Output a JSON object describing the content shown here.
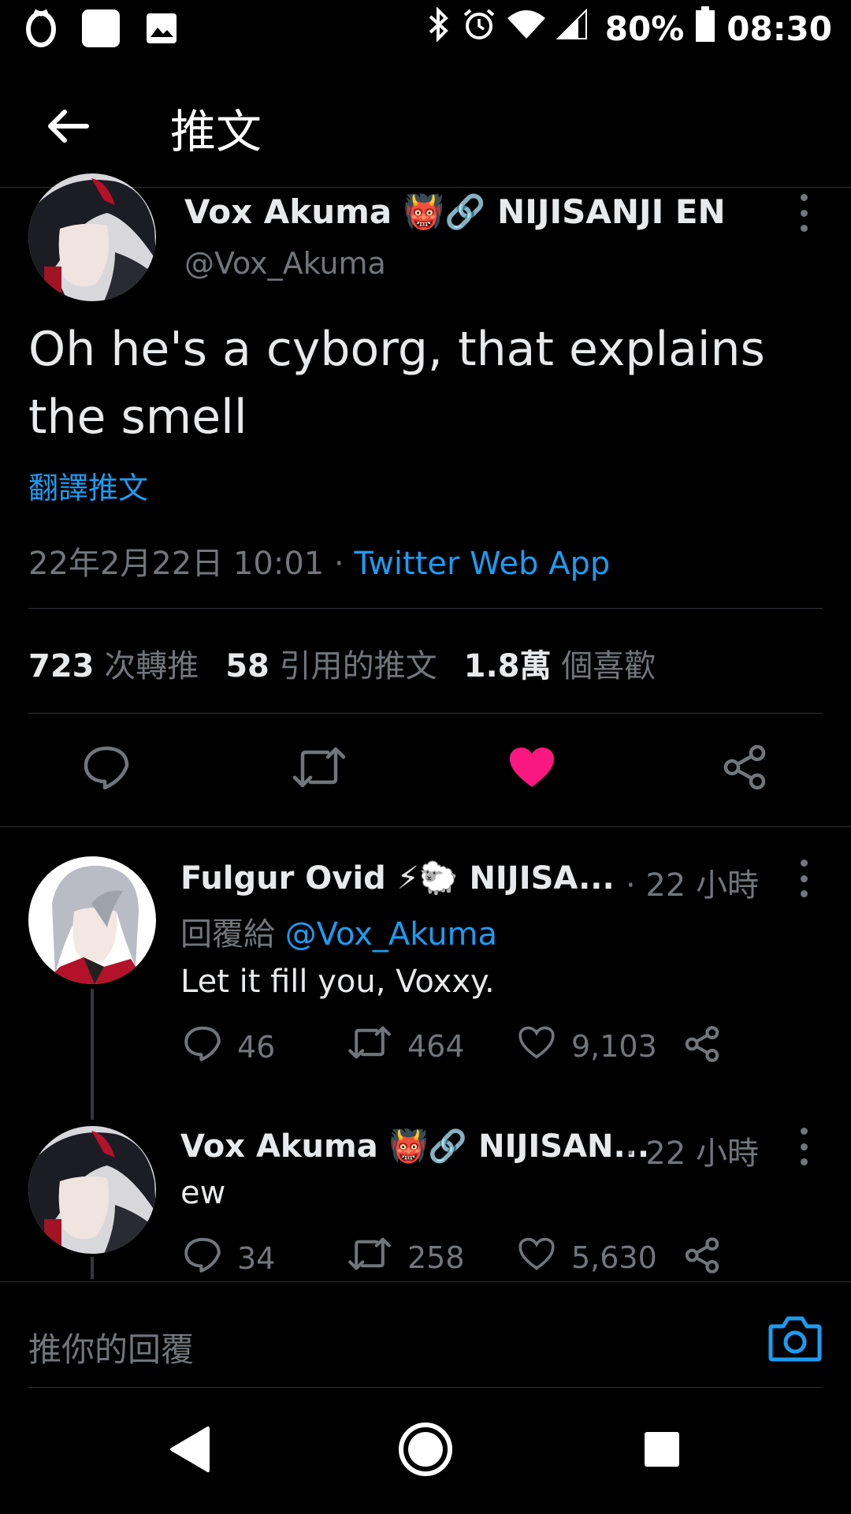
{
  "status_bar": {
    "battery_percent": "80%",
    "time": "08:30"
  },
  "header": {
    "title": "推文"
  },
  "main_tweet": {
    "author_name": "Vox Akuma 👹🔗 NIJISANJI EN",
    "author_handle": "@Vox_Akuma",
    "text": "Oh he's a cyborg, that explains the smell",
    "translate_label": "翻譯推文",
    "timestamp": "22年2月22日 10:01",
    "separator": " · ",
    "source": "Twitter Web App",
    "stats": {
      "retweets_count": "723",
      "retweets_label": "次轉推",
      "quotes_count": "58",
      "quotes_label": "引用的推文",
      "likes_count": "1.8萬",
      "likes_label": "個喜歡"
    },
    "liked": true
  },
  "replies": [
    {
      "author_name": "Fulgur Ovid ⚡🐑 NIJISA...",
      "time": "· 22 小時",
      "reply_to_label": "回覆給",
      "reply_to_handle": "@Vox_Akuma",
      "text": "Let it fill you, Voxxy.",
      "reply_count": "46",
      "retweet_count": "464",
      "like_count": "9,103"
    },
    {
      "author_name": "Vox Akuma 👹🔗 NIJISAN...",
      "time": "· 22 小時",
      "text": "ew",
      "reply_count": "34",
      "retweet_count": "258",
      "like_count": "5,630"
    }
  ],
  "composer": {
    "placeholder": "推你的回覆"
  },
  "colors": {
    "background": "#000000",
    "accent": "#1d9bf0",
    "like": "#f91880",
    "muted": "#71767b"
  }
}
